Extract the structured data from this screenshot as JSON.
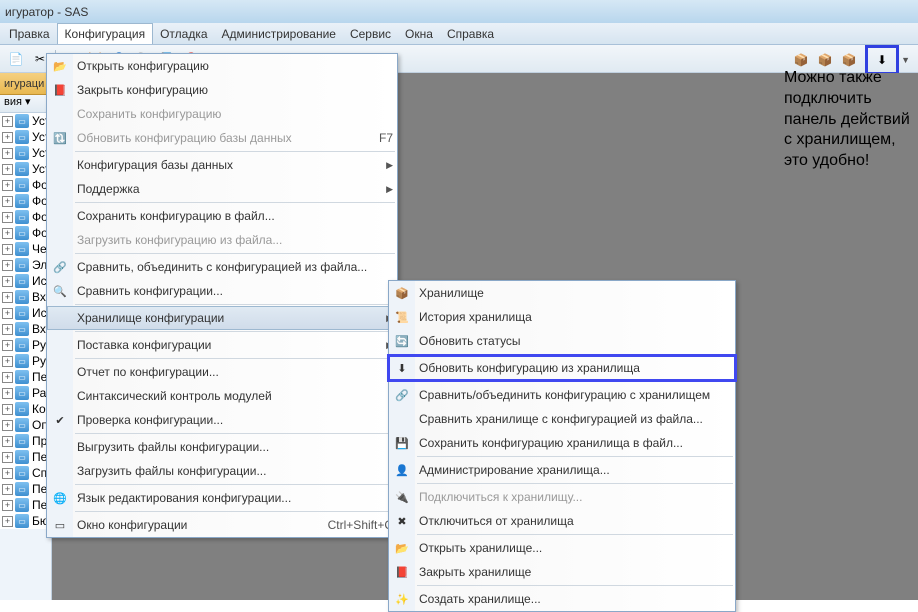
{
  "window": {
    "title": "игуратор - SAS"
  },
  "menubar": {
    "items": [
      "Правка",
      "Конфигурация",
      "Отладка",
      "Администрирование",
      "Сервис",
      "Окна",
      "Справка"
    ],
    "active_index": 1
  },
  "sidebar": {
    "tab": "игураци",
    "filter": "вия ▾"
  },
  "tree": {
    "items": [
      {
        "label": "Уст",
        "lock": false
      },
      {
        "label": "Уст",
        "lock": false
      },
      {
        "label": "Уст",
        "lock": false
      },
      {
        "label": "Уст",
        "lock": false
      },
      {
        "label": "Фор",
        "lock": false
      },
      {
        "label": "Фор",
        "lock": false
      },
      {
        "label": "Фор",
        "lock": false
      },
      {
        "label": "Фор",
        "lock": false
      },
      {
        "label": "Чек",
        "lock": false
      },
      {
        "label": "Эле",
        "lock": false
      },
      {
        "label": "Исх",
        "lock": false
      },
      {
        "label": "Вхо",
        "lock": false
      },
      {
        "label": "Исх",
        "lock": false
      },
      {
        "label": "Вхо",
        "lock": false
      },
      {
        "label": "Руч",
        "lock": false
      },
      {
        "label": "Руч",
        "lock": false
      },
      {
        "label": "Пер",
        "lock": false
      },
      {
        "label": "Рас",
        "lock": false
      },
      {
        "label": "Кор",
        "lock": false
      },
      {
        "label": "Опе",
        "lock": false
      },
      {
        "label": "ПринятиеКУчетуОС",
        "lock": true
      },
      {
        "label": "ПеремещениеОС",
        "lock": true
      },
      {
        "label": "СписаниеОС",
        "lock": true
      },
      {
        "label": "ПередачаОС",
        "lock": true
      },
      {
        "label": "ПереоценкаОС",
        "lock": true
      },
      {
        "label": "БюджетДоходовИРасходов",
        "lock": true
      }
    ]
  },
  "dropdown": {
    "items": [
      {
        "label": "Открыть конфигурацию",
        "icon": "📂",
        "type": "item"
      },
      {
        "label": "Закрыть конфигурацию",
        "icon": "📕",
        "type": "item"
      },
      {
        "label": "Сохранить конфигурацию",
        "icon": "",
        "type": "item",
        "disabled": true
      },
      {
        "label": "Обновить конфигурацию базы данных",
        "icon": "🔃",
        "type": "item",
        "disabled": true,
        "shortcut": "F7"
      },
      {
        "type": "sep"
      },
      {
        "label": "Конфигурация базы данных",
        "type": "sub"
      },
      {
        "label": "Поддержка",
        "type": "sub"
      },
      {
        "type": "sep"
      },
      {
        "label": "Сохранить конфигурацию в файл...",
        "type": "item"
      },
      {
        "label": "Загрузить конфигурацию из файла...",
        "type": "item",
        "disabled": true
      },
      {
        "type": "sep"
      },
      {
        "label": "Сравнить, объединить с конфигурацией из файла...",
        "icon": "🔗",
        "type": "item"
      },
      {
        "label": "Сравнить конфигурации...",
        "icon": "🔍",
        "type": "item"
      },
      {
        "type": "sep"
      },
      {
        "label": "Хранилище конфигурации",
        "type": "sub",
        "hover": true
      },
      {
        "type": "sep"
      },
      {
        "label": "Поставка конфигурации",
        "type": "sub"
      },
      {
        "type": "sep"
      },
      {
        "label": "Отчет по конфигурации...",
        "type": "item"
      },
      {
        "label": "Синтаксический контроль модулей",
        "type": "item"
      },
      {
        "label": "Проверка конфигурации...",
        "icon": "✔",
        "type": "item"
      },
      {
        "type": "sep"
      },
      {
        "label": "Выгрузить файлы конфигурации...",
        "type": "item"
      },
      {
        "label": "Загрузить файлы конфигурации...",
        "type": "item"
      },
      {
        "type": "sep"
      },
      {
        "label": "Язык редактирования конфигурации...",
        "icon": "🌐",
        "type": "item"
      },
      {
        "type": "sep"
      },
      {
        "label": "Окно конфигурации",
        "icon": "▭",
        "type": "item",
        "shortcut": "Ctrl+Shift+C"
      }
    ]
  },
  "submenu": {
    "items": [
      {
        "label": "Хранилище",
        "icon": "📦",
        "type": "item"
      },
      {
        "label": "История хранилища",
        "icon": "📜",
        "type": "item"
      },
      {
        "label": "Обновить статусы",
        "icon": "🔄",
        "type": "item"
      },
      {
        "type": "sep"
      },
      {
        "label": "Обновить конфигурацию из хранилища",
        "icon": "⬇",
        "type": "item",
        "highlight": true
      },
      {
        "type": "sep"
      },
      {
        "label": "Сравнить/объединить конфигурацию с хранилищем",
        "icon": "🔗",
        "type": "item"
      },
      {
        "label": "Сравнить хранилище с конфигурацией из файла...",
        "type": "item"
      },
      {
        "label": "Сохранить конфигурацию хранилища в файл...",
        "icon": "💾",
        "type": "item"
      },
      {
        "type": "sep"
      },
      {
        "label": "Администрирование хранилища...",
        "icon": "👤",
        "type": "item"
      },
      {
        "type": "sep"
      },
      {
        "label": "Подключиться к хранилищу...",
        "icon": "🔌",
        "type": "item",
        "disabled": true
      },
      {
        "label": "Отключиться от хранилища",
        "icon": "✖",
        "type": "item"
      },
      {
        "type": "sep"
      },
      {
        "label": "Открыть хранилище...",
        "icon": "📂",
        "type": "item"
      },
      {
        "label": "Закрыть хранилище",
        "icon": "📕",
        "type": "item"
      },
      {
        "type": "sep"
      },
      {
        "label": "Создать хранилище...",
        "icon": "✨",
        "type": "item"
      }
    ]
  },
  "annotation": "Можно также подключить панель действий с хранилищем, это удобно!"
}
